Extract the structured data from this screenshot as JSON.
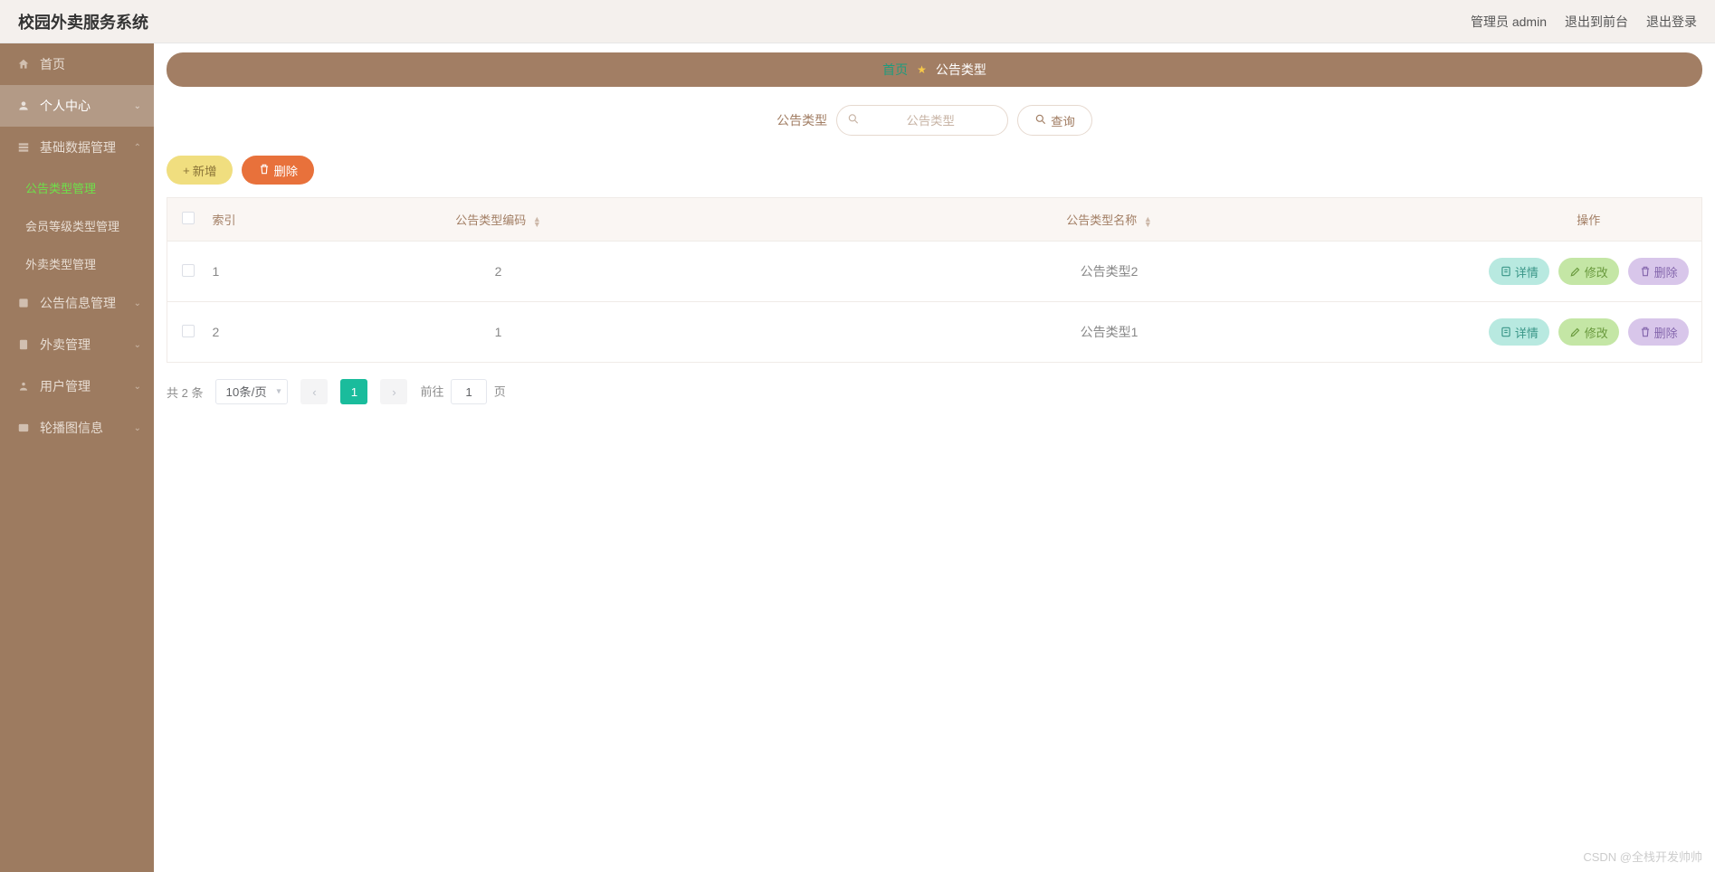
{
  "header": {
    "title": "校园外卖服务系统",
    "admin": "管理员 admin",
    "back_to_front": "退出到前台",
    "logout": "退出登录"
  },
  "sidebar": {
    "home": "首页",
    "personal": "个人中心",
    "basic": "基础数据管理",
    "sub_notice_type": "公告类型管理",
    "sub_member_level": "会员等级类型管理",
    "sub_delivery_type": "外卖类型管理",
    "notice_info": "公告信息管理",
    "delivery": "外卖管理",
    "user": "用户管理",
    "carousel": "轮播图信息"
  },
  "breadcrumb": {
    "home": "首页",
    "current": "公告类型"
  },
  "search": {
    "label": "公告类型",
    "placeholder": "公告类型",
    "query": "查询"
  },
  "actions": {
    "add": "新增",
    "delete": "删除"
  },
  "table": {
    "headers": {
      "index": "索引",
      "code": "公告类型编码",
      "name": "公告类型名称",
      "action": "操作"
    },
    "buttons": {
      "detail": "详情",
      "edit": "修改",
      "delete": "删除"
    },
    "rows": [
      {
        "index": "1",
        "code": "2",
        "name": "公告类型2"
      },
      {
        "index": "2",
        "code": "1",
        "name": "公告类型1"
      }
    ]
  },
  "pagination": {
    "total": "共 2 条",
    "page_size": "10条/页",
    "current": "1",
    "goto_prefix": "前往",
    "goto_value": "1",
    "goto_suffix": "页"
  },
  "watermark": "CSDN @全栈开发帅帅"
}
